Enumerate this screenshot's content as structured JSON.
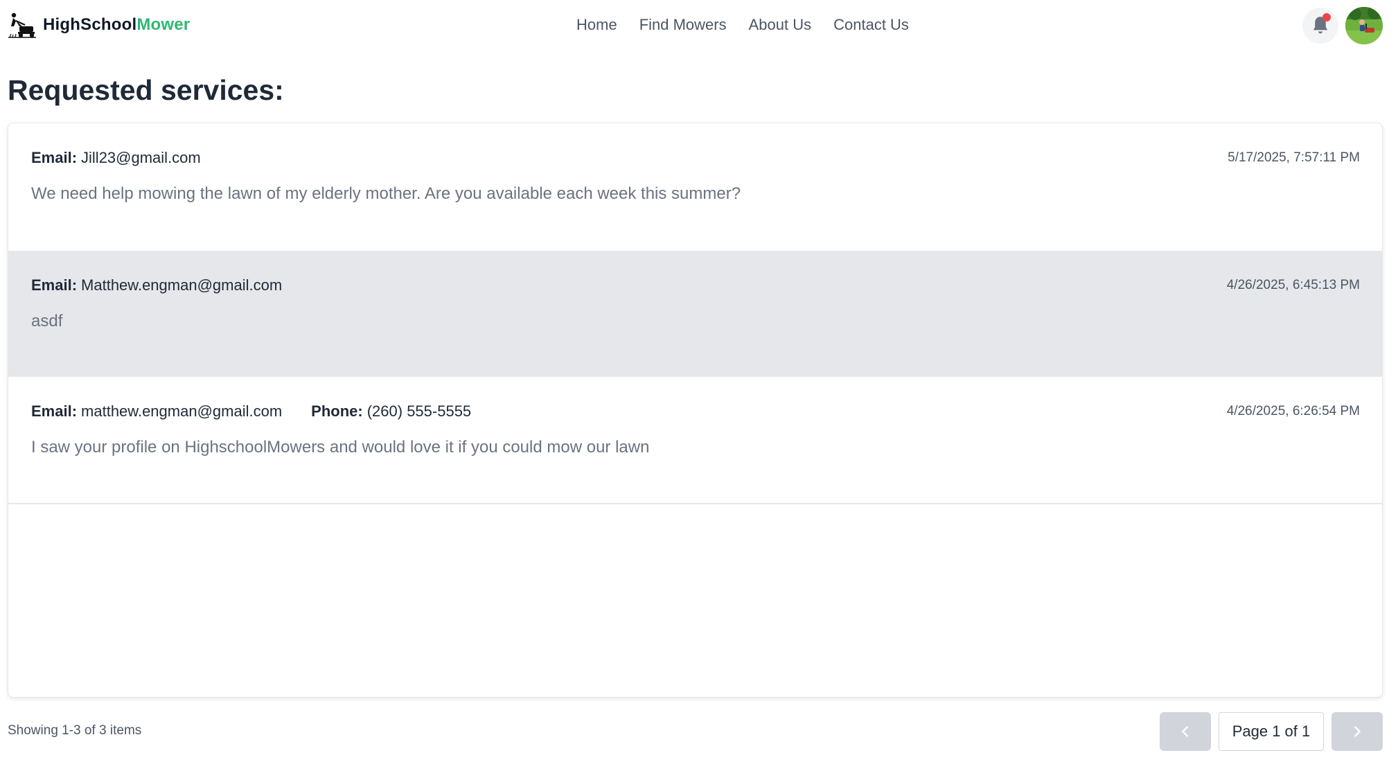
{
  "header": {
    "brand_part1": "HighSchool",
    "brand_part2": "Mower",
    "nav": [
      "Home",
      "Find Mowers",
      "About Us",
      "Contact Us"
    ],
    "brand_accent_color": "#2eb872",
    "notification_icon": "bell-icon",
    "notification_dot_color": "#ef4444"
  },
  "main": {
    "title": "Requested services:",
    "requests": [
      {
        "email_label": "Email:",
        "email": "Jill23@gmail.com",
        "phone_label": "",
        "phone": "",
        "timestamp": "5/17/2025, 7:57:11 PM",
        "message": "We need help mowing the lawn of my elderly mother. Are you available each week this summer?"
      },
      {
        "email_label": "Email:",
        "email": "Matthew.engman@gmail.com",
        "phone_label": "",
        "phone": "",
        "timestamp": "4/26/2025, 6:45:13 PM",
        "message": "asdf"
      },
      {
        "email_label": "Email:",
        "email": "matthew.engman@gmail.com",
        "phone_label": "Phone:",
        "phone": "(260) 555-5555",
        "timestamp": "4/26/2025, 6:26:54 PM",
        "message": "I saw your profile on HighschoolMowers and would love it if you could mow our lawn"
      }
    ]
  },
  "footer": {
    "showing": "Showing 1-3 of 3 items",
    "page_indicator": "Page 1 of 1",
    "prev_icon": "chevron-left-icon",
    "next_icon": "chevron-right-icon"
  }
}
